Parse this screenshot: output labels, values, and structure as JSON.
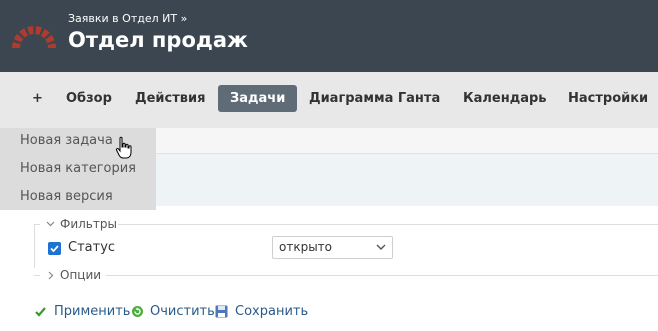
{
  "header": {
    "parent_project": "Заявки в Отдел ИТ »",
    "project_title": "Отдел продаж",
    "logo_icon": "arc-logo-icon",
    "logo_color": "#b03a2e"
  },
  "menu": {
    "items": [
      {
        "label": "+"
      },
      {
        "label": "Обзор"
      },
      {
        "label": "Действия"
      },
      {
        "label": "Задачи"
      },
      {
        "label": "Диаграмма Ганта"
      },
      {
        "label": "Календарь"
      },
      {
        "label": "Настройки"
      }
    ],
    "active": "Задачи",
    "active_color": "#5f6c78"
  },
  "new_menu": {
    "items": [
      {
        "label": "Новая задача"
      },
      {
        "label": "Новая категория"
      },
      {
        "label": "Новая версия"
      }
    ]
  },
  "filters": {
    "legend": "Фильтры",
    "status_label": "Статус",
    "status_checked": true,
    "status_value": "открыто"
  },
  "options": {
    "legend": "Опции"
  },
  "actions": {
    "apply": "Применить",
    "clear": "Очистить",
    "save": "Сохранить"
  }
}
